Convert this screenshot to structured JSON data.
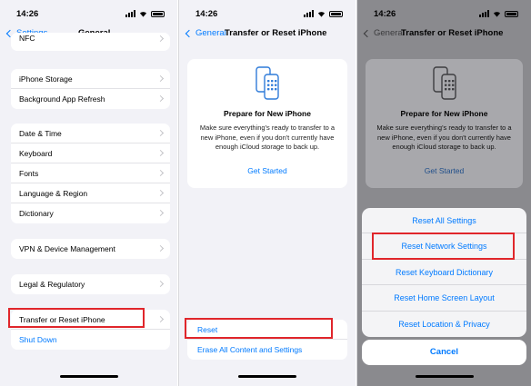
{
  "status": {
    "time": "14:26"
  },
  "screen1": {
    "back_label": "Settings",
    "title": "General",
    "group1": [
      "NFC"
    ],
    "group2": [
      "iPhone Storage",
      "Background App Refresh"
    ],
    "group3": [
      "Date & Time",
      "Keyboard",
      "Fonts",
      "Language & Region",
      "Dictionary"
    ],
    "group4": [
      "VPN & Device Management"
    ],
    "group5": [
      "Legal & Regulatory"
    ],
    "group6": [
      "Transfer or Reset iPhone",
      "Shut Down"
    ]
  },
  "screen2": {
    "back_label": "General",
    "title": "Transfer or Reset iPhone",
    "card": {
      "title": "Prepare for New iPhone",
      "description": "Make sure everything's ready to transfer to a new iPhone, even if you don't currently have enough iCloud storage to back up.",
      "button": "Get Started"
    },
    "reset_items": [
      "Reset",
      "Erase All Content and Settings"
    ]
  },
  "screen3": {
    "back_label": "General",
    "title": "Transfer or Reset iPhone",
    "card": {
      "title": "Prepare for New iPhone",
      "description": "Make sure everything's ready to transfer to a new iPhone, even if you don't currently have enough iCloud storage to back up.",
      "button": "Get Started"
    },
    "sheet_items": [
      "Reset All Settings",
      "Reset Network Settings",
      "Reset Keyboard Dictionary",
      "Reset Home Screen Layout",
      "Reset Location & Privacy"
    ],
    "cancel": "Cancel"
  },
  "colors": {
    "accent": "#007aff",
    "highlight": "#e0262b",
    "background": "#f2f2f7"
  }
}
